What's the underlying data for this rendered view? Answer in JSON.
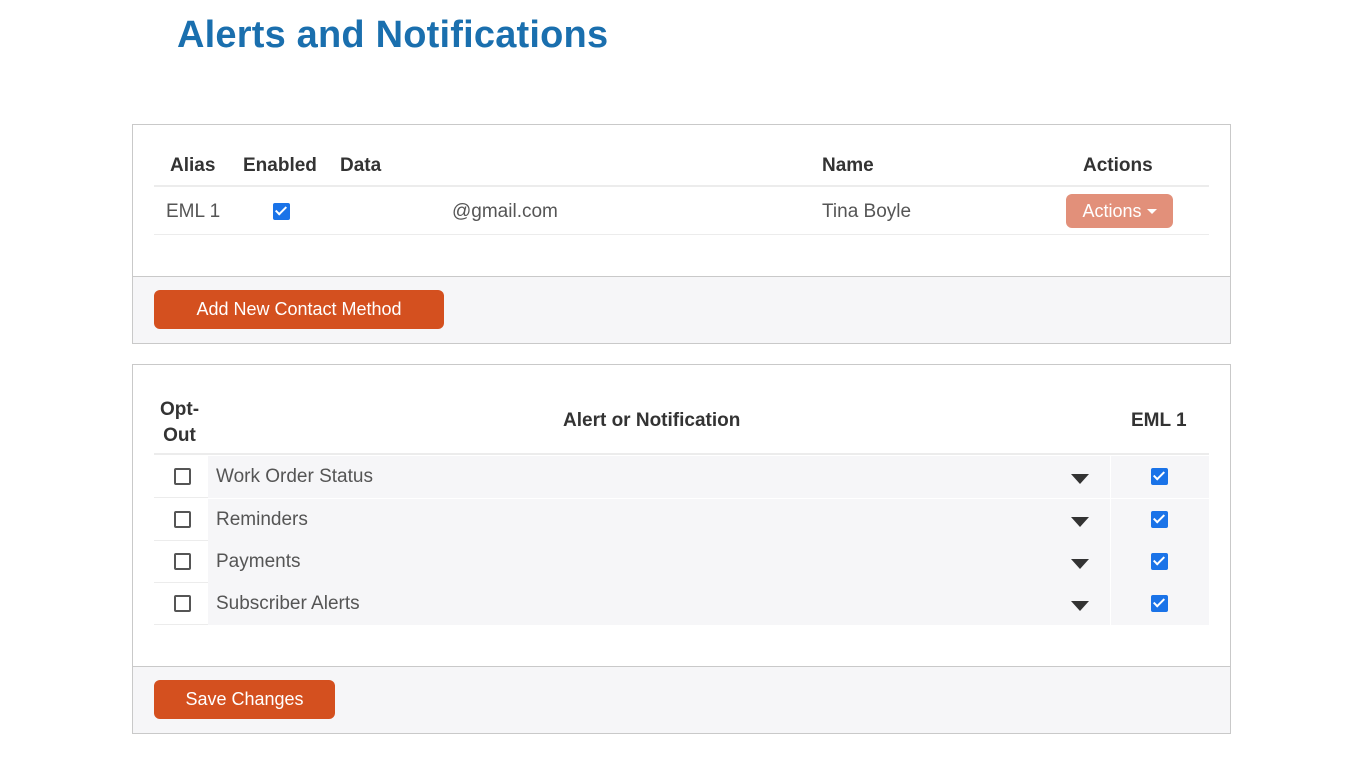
{
  "page": {
    "title": "Alerts and Notifications"
  },
  "contacts": {
    "headers": {
      "alias": "Alias",
      "enabled": "Enabled",
      "data": "Data",
      "name": "Name",
      "actions": "Actions"
    },
    "rows": [
      {
        "alias": "EML 1",
        "enabled": true,
        "data": "@gmail.com",
        "name": "Tina Boyle",
        "actions_label": "Actions"
      }
    ],
    "add_button_label": "Add New Contact Method"
  },
  "alerts": {
    "headers": {
      "optout": "Opt-Out",
      "optout_line1": "Opt-",
      "optout_line2": "Out",
      "alert": "Alert or Notification",
      "eml": "EML 1"
    },
    "rows": [
      {
        "label": "Work Order Status",
        "opt_out": false,
        "eml1": true
      },
      {
        "label": "Reminders",
        "opt_out": false,
        "eml1": true
      },
      {
        "label": "Payments",
        "opt_out": false,
        "eml1": true
      },
      {
        "label": "Subscriber Alerts",
        "opt_out": false,
        "eml1": true
      }
    ],
    "save_button_label": "Save Changes"
  },
  "colors": {
    "title": "#1a6fae",
    "primary_button": "#d4501f",
    "actions_button": "#e2907a",
    "checkbox": "#1a73e8"
  },
  "icons": {
    "expand": "caret-down-icon",
    "dropdown": "caret-down-icon"
  }
}
